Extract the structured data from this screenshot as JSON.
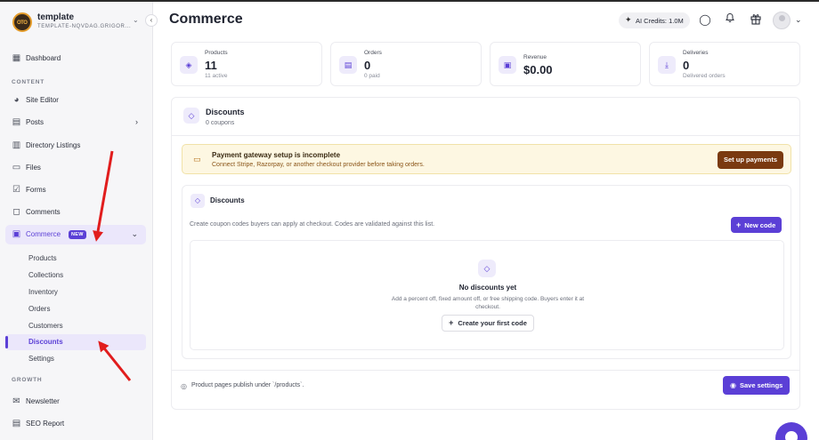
{
  "workspace": {
    "name": "template",
    "subtitle": "TEMPLATE-NQVDAG.GRIGOR..."
  },
  "sidebar": {
    "top": [
      {
        "label": "Dashboard",
        "icon": "dashboard-icon"
      }
    ],
    "content_label": "CONTENT",
    "content": [
      {
        "label": "Site Editor",
        "icon": "palette-icon"
      },
      {
        "label": "Posts",
        "icon": "document-icon"
      },
      {
        "label": "Directory Listings",
        "icon": "book-icon"
      },
      {
        "label": "Files",
        "icon": "folder-icon"
      },
      {
        "label": "Forms",
        "icon": "clipboard-check-icon"
      },
      {
        "label": "Comments",
        "icon": "comment-icon"
      }
    ],
    "commerce": {
      "label": "Commerce",
      "badge": "NEW"
    },
    "commerce_sub": [
      "Products",
      "Collections",
      "Inventory",
      "Orders",
      "Customers",
      "Discounts",
      "Settings"
    ],
    "growth_label": "GROWTH",
    "growth": [
      {
        "label": "Newsletter",
        "icon": "mail-icon"
      },
      {
        "label": "SEO Report",
        "icon": "seo-report-icon"
      }
    ]
  },
  "header": {
    "title": "Commerce",
    "credits": "AI Credits: 1.0M"
  },
  "stats": [
    {
      "label": "Products",
      "value": "11",
      "sub": "11 active"
    },
    {
      "label": "Orders",
      "value": "0",
      "sub": "0 paid"
    },
    {
      "label": "Revenue",
      "value": "$0.00",
      "sub": ""
    },
    {
      "label": "Deliveries",
      "value": "0",
      "sub": "Delivered orders"
    }
  ],
  "panel": {
    "title": "Discounts",
    "subtitle": "0 coupons",
    "alert": {
      "title": "Payment gateway setup is incomplete",
      "message": "Connect Stripe, Razorpay, or another checkout provider before taking orders.",
      "button": "Set up payments"
    },
    "section": {
      "title": "Discounts",
      "description": "Create coupon codes buyers can apply at checkout. Codes are validated against this list.",
      "new_button": "New code",
      "empty": {
        "title": "No discounts yet",
        "description": "Add a percent off, fixed amount off, or free shipping code. Buyers enter it at checkout.",
        "button": "Create your first code"
      }
    },
    "footer": {
      "note": "Product pages publish under `/products`.",
      "save_button": "Save settings"
    }
  },
  "colors": {
    "accent": "#5b3fd6",
    "accent_soft": "#ebe7fb",
    "warning_bg": "#fdf7e2",
    "warning_btn": "#7a3a10",
    "annotation_arrow": "#e11d1d"
  }
}
